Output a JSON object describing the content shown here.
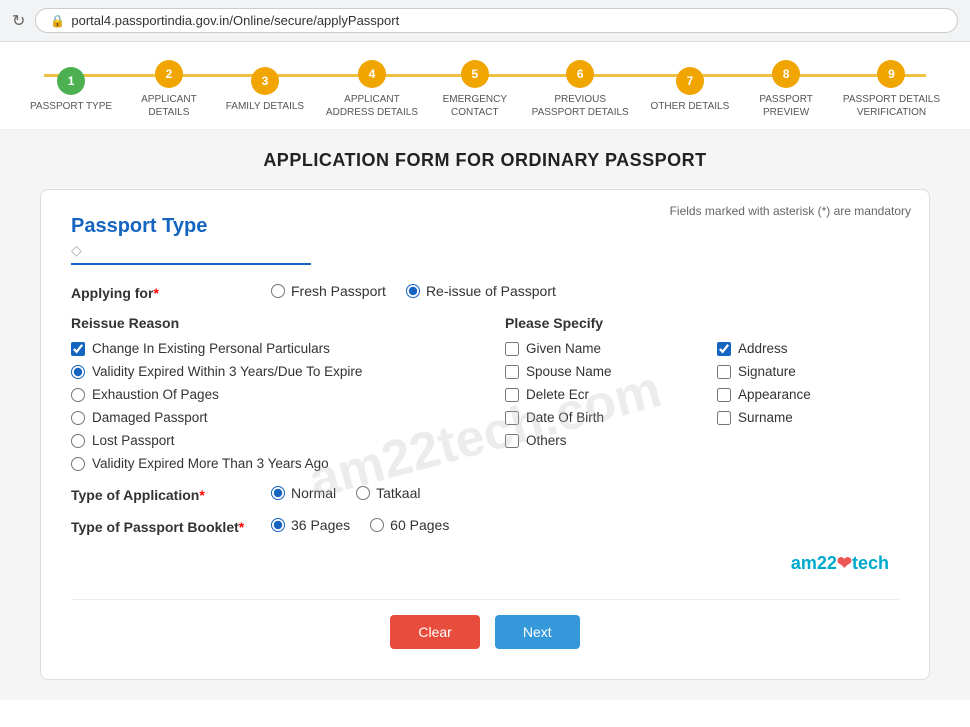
{
  "browser": {
    "url": "portal4.passportindia.gov.in/Online/secure/applyPassport",
    "lock_symbol": "🔒"
  },
  "progress": {
    "steps": [
      {
        "number": "1",
        "label": "PASSPORT TYPE",
        "state": "completed"
      },
      {
        "number": "2",
        "label": "APPLICANT\nDETAILS",
        "state": "active"
      },
      {
        "number": "3",
        "label": "FAMILY DETAILS",
        "state": "pending"
      },
      {
        "number": "4",
        "label": "APPLICANT\nADDRESS DETAILS",
        "state": "pending"
      },
      {
        "number": "5",
        "label": "EMERGENCY\nCONTACT",
        "state": "pending"
      },
      {
        "number": "6",
        "label": "PREVIOUS\nPASSPORT DETAILS",
        "state": "pending"
      },
      {
        "number": "7",
        "label": "OTHER DETAILS",
        "state": "pending"
      },
      {
        "number": "8",
        "label": "PASSPORT\nPREVIEW",
        "state": "pending"
      },
      {
        "number": "9",
        "label": "PASSPORT DETAILS\nVERIFICATION",
        "state": "pending"
      }
    ]
  },
  "page_title": "APPLICATION FORM FOR ORDINARY PASSPORT",
  "form": {
    "section_title": "Passport Type",
    "mandatory_note": "Fields marked with asterisk (*) are mandatory",
    "applying_for_label": "Applying for",
    "applying_for_options": [
      "Fresh Passport",
      "Re-issue of Passport"
    ],
    "applying_for_selected": "Re-issue of Passport",
    "reissue_reason_label": "Reissue Reason",
    "reissue_reasons": [
      {
        "label": "Change In Existing Personal Particulars",
        "checked": true,
        "type": "checkbox"
      },
      {
        "label": "Validity Expired Within 3 Years/Due To Expire",
        "checked": true,
        "type": "radio"
      },
      {
        "label": "Exhaustion Of Pages",
        "checked": false,
        "type": "radio"
      },
      {
        "label": "Damaged Passport",
        "checked": false,
        "type": "radio"
      },
      {
        "label": "Lost Passport",
        "checked": false,
        "type": "radio"
      },
      {
        "label": "Validity Expired More Than 3 Years Ago",
        "checked": false,
        "type": "radio"
      }
    ],
    "please_specify_label": "Please Specify",
    "please_specify_items": [
      {
        "label": "Given Name",
        "checked": false,
        "col": 1
      },
      {
        "label": "Address",
        "checked": true,
        "col": 2
      },
      {
        "label": "Spouse Name",
        "checked": false,
        "col": 1
      },
      {
        "label": "Signature",
        "checked": false,
        "col": 2
      },
      {
        "label": "Delete Ecr",
        "checked": false,
        "col": 1
      },
      {
        "label": "Appearance",
        "checked": false,
        "col": 2
      },
      {
        "label": "Date Of Birth",
        "checked": false,
        "col": 1
      },
      {
        "label": "Surname",
        "checked": false,
        "col": 2
      },
      {
        "label": "Others",
        "checked": false,
        "col": 1
      }
    ],
    "type_of_application_label": "Type of Application",
    "type_of_application_options": [
      "Normal",
      "Tatkaal"
    ],
    "type_of_application_selected": "Normal",
    "type_of_booklet_label": "Type of Passport Booklet",
    "type_of_booklet_options": [
      "36 Pages",
      "60 Pages"
    ],
    "type_of_booklet_selected": "36 Pages",
    "btn_clear": "Clear",
    "btn_next": "Next"
  },
  "branding": {
    "text": "am22tech",
    "heart": "❤"
  }
}
